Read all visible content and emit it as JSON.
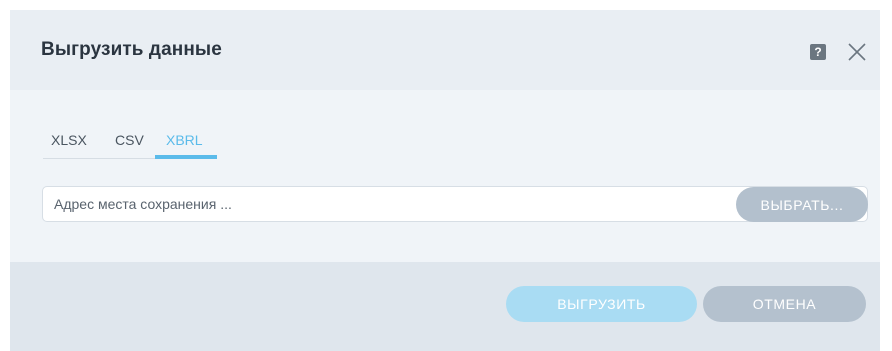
{
  "dialog": {
    "title": "Выгрузить данные",
    "help_icon": "help-icon",
    "help_glyph": "?",
    "close_icon": "close-icon"
  },
  "tabs": [
    {
      "label": "XLSX",
      "active": false
    },
    {
      "label": "CSV",
      "active": false
    },
    {
      "label": "XBRL",
      "active": true
    }
  ],
  "save_path": {
    "value": "",
    "placeholder": "Адрес места сохранения ...",
    "browse_label": "ВЫБРАТЬ..."
  },
  "footer": {
    "export_label": "ВЫГРУЗИТЬ",
    "cancel_label": "ОТМЕНА"
  },
  "colors": {
    "accent": "#5bbbea",
    "header_bg": "#e9eef3",
    "body_bg": "#f0f4f8",
    "footer_bg": "#dfe6ed",
    "button_grey": "#b4c1ce",
    "button_primary_disabled": "#a9dcf3"
  }
}
